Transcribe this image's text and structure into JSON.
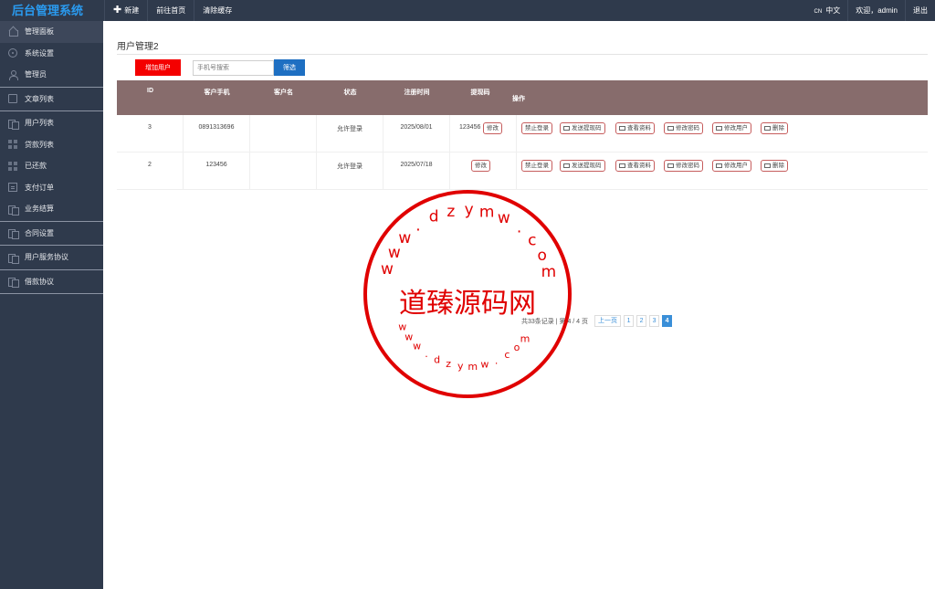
{
  "header": {
    "brand": "后台管理系统",
    "nav": [
      {
        "label": "新建",
        "icon": "plus-icon"
      },
      {
        "label": "前往首页"
      },
      {
        "label": "清除缓存"
      }
    ],
    "lang_tag": "CN",
    "lang_label": "中文",
    "welcome": "欢迎，admin",
    "logout": "退出"
  },
  "sidebar": {
    "items": [
      {
        "label": "管理面板",
        "icon": "home-icon"
      },
      {
        "label": "系统设置",
        "icon": "gear-icon"
      },
      {
        "label": "管理员",
        "icon": "user-icon"
      },
      {
        "label": "文章列表",
        "icon": "document-icon"
      },
      {
        "label": "用户列表",
        "icon": "users-icon"
      },
      {
        "label": "贷款列表",
        "icon": "grid-icon"
      },
      {
        "label": "已还款",
        "icon": "grid-icon"
      },
      {
        "label": "支付订单",
        "icon": "box-icon"
      },
      {
        "label": "业务结算",
        "icon": "users-icon"
      },
      {
        "label": "合同设置",
        "icon": "users-icon"
      },
      {
        "label": "用户服务协议",
        "icon": "users-icon"
      },
      {
        "label": "借款协议",
        "icon": "users-icon"
      }
    ]
  },
  "main": {
    "title": "用户管理2",
    "add_button": "增加用户",
    "search_placeholder": "手机号搜索",
    "filter_button": "筛选",
    "columns": [
      "ID",
      "客户手机",
      "客户名",
      "状态",
      "注册时间",
      "提现码",
      "操作"
    ],
    "rows": [
      {
        "id": "3",
        "phone": "0891313696",
        "name": "",
        "status": "允许登录",
        "reg_time": "2025/08/01",
        "code": "123456",
        "edit": "修改"
      },
      {
        "id": "2",
        "phone": "123456",
        "name": "",
        "status": "允许登录",
        "reg_time": "2025/07/18",
        "code": "",
        "edit": "修改"
      }
    ],
    "actions": [
      {
        "label": "禁止登录"
      },
      {
        "label": "发送提现码",
        "icon": "card-icon"
      },
      {
        "label": "查看资料",
        "icon": "card-icon"
      },
      {
        "label": "修改密码",
        "icon": "edit-icon"
      },
      {
        "label": "修改用户",
        "icon": "edit-icon"
      },
      {
        "label": "删除",
        "icon": "trash-icon"
      }
    ]
  },
  "pagination": {
    "info": "共33条记录 | 第 4 / 4 页",
    "prev": "上一页",
    "pages": [
      "1",
      "2",
      "3",
      "4"
    ],
    "current": "4"
  },
  "watermark": {
    "center_text": "道臻源码网",
    "ring_text": "www.dzymw.com"
  },
  "colors": {
    "sidebar_bg": "#2f3a4c",
    "brand": "#2a9bf0",
    "add_button": "#f40000",
    "filter_button": "#1e6fc2",
    "table_header": "#876c6c",
    "stamp": "#e00000"
  }
}
